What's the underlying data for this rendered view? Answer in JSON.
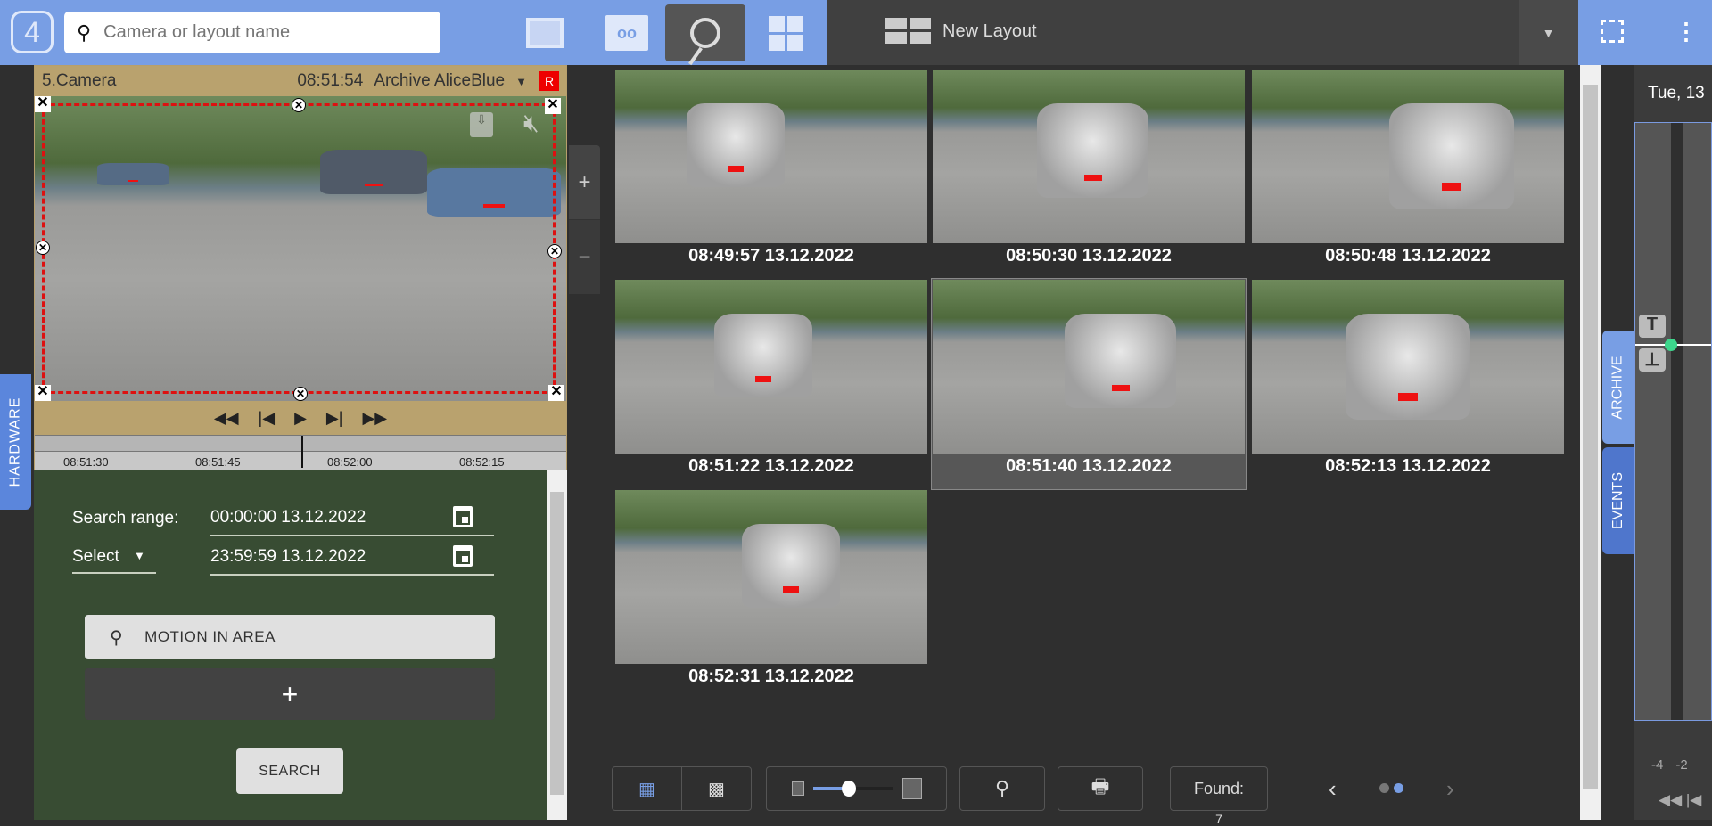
{
  "header": {
    "logo": "4",
    "search_placeholder": "Camera or layout name",
    "layout_name": "New Layout",
    "nav": [
      "monitor-icon",
      "archive-tape-icon",
      "search-icon",
      "layouts-icon"
    ]
  },
  "hardware_tab": "HARDWARE",
  "camera": {
    "name": "5.Camera",
    "time": "08:51:54",
    "mode": "Archive AliceBlue",
    "badge": "R",
    "timeline_labels": [
      "08:51:30",
      "08:51:45",
      "08:52:00",
      "08:52:15"
    ]
  },
  "zoom": {
    "plus": "+",
    "minus": "−"
  },
  "search": {
    "range_label": "Search range:",
    "from": "00:00:00 13.12.2022",
    "select_label": "Select",
    "to": "23:59:59 13.12.2022",
    "motion_label": "MOTION IN AREA",
    "add_label": "+",
    "search_label": "SEARCH"
  },
  "results": [
    {
      "caption": "08:49:57 13.12.2022"
    },
    {
      "caption": "08:50:30 13.12.2022"
    },
    {
      "caption": "08:50:48 13.12.2022"
    },
    {
      "caption": "08:51:22 13.12.2022"
    },
    {
      "caption": "08:51:40 13.12.2022",
      "selected": true
    },
    {
      "caption": "08:52:13 13.12.2022"
    },
    {
      "caption": "08:52:31 13.12.2022"
    }
  ],
  "footer": {
    "found_label": "Found:",
    "found_count": "7",
    "slider_value": 0.45,
    "page_current": 2,
    "page_total": 2
  },
  "archive": {
    "date": "Tue, 13",
    "tab_archive": "ARCHIVE",
    "tab_events": "EVENTS",
    "scale": [
      "-4",
      "-2"
    ]
  },
  "colors": {
    "accent": "#789ee4",
    "camera_header": "#b9a26e",
    "search_panel": "#384c33"
  }
}
